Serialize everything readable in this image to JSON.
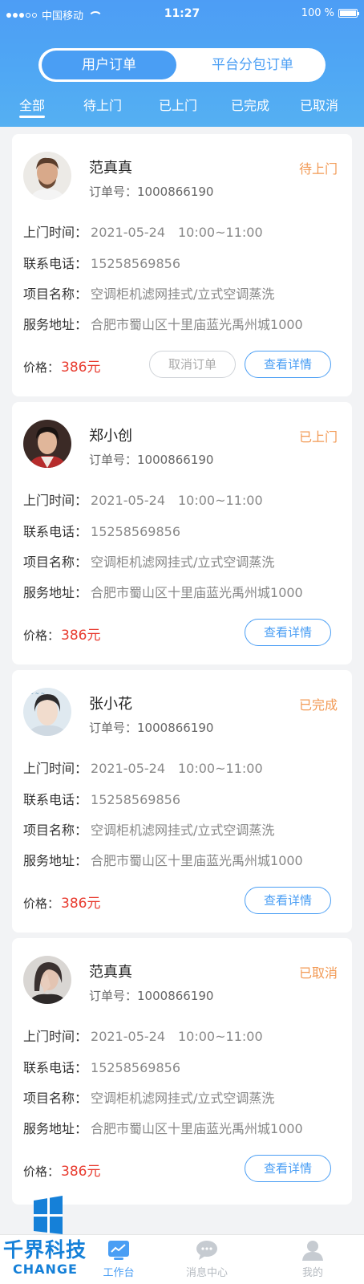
{
  "status_bar": {
    "carrier": "中国移动",
    "time": "11:27",
    "battery_text": "100 %"
  },
  "segmented": {
    "user_orders": "用户订单",
    "platform_orders": "平台分包订单"
  },
  "tabs": [
    "全部",
    "待上门",
    "已上门",
    "已完成",
    "已取消"
  ],
  "labels": {
    "time": "上门时间：",
    "phone": "联系电话：",
    "project": "项目名称：",
    "address": "服务地址：",
    "price": "价格：",
    "order_prefix": "订单号：",
    "cancel": "取消订单",
    "detail": "查看详情"
  },
  "orders": [
    {
      "name": "范真真",
      "status": "待上门",
      "order_no": "1000866190",
      "time": "2021-05-24　10:00~11:00",
      "phone": "15258569856",
      "project": "空调柜机滤网挂式/立式空调蒸洗",
      "address": "合肥市蜀山区十里庙蓝光禹州城1000",
      "price": "386元"
    },
    {
      "name": "郑小创",
      "status": "已上门",
      "order_no": "1000866190",
      "time": "2021-05-24　10:00~11:00",
      "phone": "15258569856",
      "project": "空调柜机滤网挂式/立式空调蒸洗",
      "address": "合肥市蜀山区十里庙蓝光禹州城1000",
      "price": "386元"
    },
    {
      "name": "张小花",
      "status": "已完成",
      "order_no": "1000866190",
      "time": "2021-05-24　10:00~11:00",
      "phone": "15258569856",
      "project": "空调柜机滤网挂式/立式空调蒸洗",
      "address": "合肥市蜀山区十里庙蓝光禹州城1000",
      "price": "386元"
    },
    {
      "name": "范真真",
      "status": "已取消",
      "order_no": "1000866190",
      "time": "2021-05-24　10:00~11:00",
      "phone": "15258569856",
      "project": "空调柜机滤网挂式/立式空调蒸洗",
      "address": "合肥市蜀山区十里庙蓝光禹州城1000",
      "price": "386元"
    }
  ],
  "bottom_nav": [
    "工作台",
    "消息中心",
    "我的"
  ],
  "watermark": {
    "title": "千界科技",
    "sub": "CHANGE"
  },
  "colors": {
    "primary": "#4a9ef4",
    "status": "#f29a55",
    "price": "#e83b2f"
  }
}
